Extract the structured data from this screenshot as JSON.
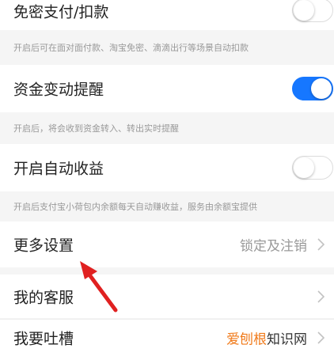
{
  "settings": {
    "mianmi": {
      "label": "免密支付/扣款",
      "enabled": false
    },
    "mianmi_hint": "开启后可在面对面付款、淘宝免密、滴滴出行等场景自动扣款",
    "zijin": {
      "label": "资金变动提醒",
      "enabled": true
    },
    "zijin_hint": "开启后，将会收到资金转入、转出实时提醒",
    "shouyi": {
      "label": "开启自动收益",
      "enabled": false
    },
    "shouyi_hint": "开启后支付宝小荷包内余额每天自动赚收益，服务由余额宝提供",
    "more": {
      "label": "更多设置",
      "value": "锁定及注销"
    },
    "kefu": {
      "label": "我的客服"
    },
    "tucao": {
      "label": "我要吐槽"
    }
  },
  "watermark": {
    "part1": "爱刨根",
    "part2": "知识网"
  },
  "colors": {
    "accent": "#1677ff",
    "arrow": "#e02020"
  }
}
